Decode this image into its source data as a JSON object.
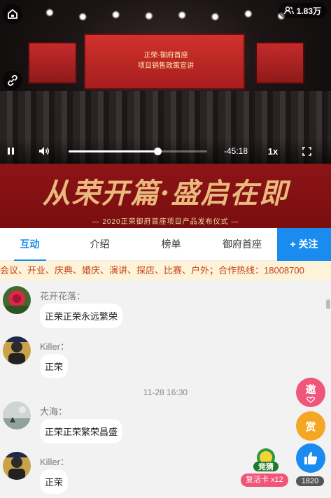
{
  "video": {
    "stage_text_line1": "正荣·御府首座",
    "stage_text_line2": "项目销售政策宣讲",
    "viewers": "1.83万",
    "progress": 0.64,
    "time_remaining": "-45:18",
    "speed": "1x"
  },
  "banner": {
    "title": "从荣开篇·盛启在即",
    "subtitle": "— 2020正荣御府首座项目产品发布仪式 —"
  },
  "tabs": [
    {
      "label": "互动",
      "active": true
    },
    {
      "label": "介绍",
      "active": false
    },
    {
      "label": "榜单",
      "active": false
    },
    {
      "label": "御府首座",
      "active": false
    }
  ],
  "follow_label": "+ 关注",
  "marquee": "会议、开业、庆典、婚庆、演讲、探店、比赛、户外；合作热线：18008700",
  "chat": {
    "messages": [
      {
        "user": "花开花落：",
        "text": "正荣正荣永远繁荣"
      },
      {
        "user": "Killer：",
        "text": "正荣"
      },
      {
        "user": "大海：",
        "text": "正荣正荣繁荣昌盛"
      },
      {
        "user": "Killer：",
        "text": "正荣"
      }
    ],
    "timestamp": "11-28 16:30"
  },
  "side": {
    "gift_label": "邀",
    "reward_label": "赏",
    "like_count": "1820",
    "quiz_icon_label": "竞猜",
    "quiz_badge": "复活卡 x12"
  },
  "colors": {
    "accent": "#1a8cf0",
    "banner": "#8c1416",
    "banner_text": "#e9b97e",
    "marquee_text": "#c8421a",
    "gift": "#f0557a",
    "reward": "#f5a623"
  }
}
